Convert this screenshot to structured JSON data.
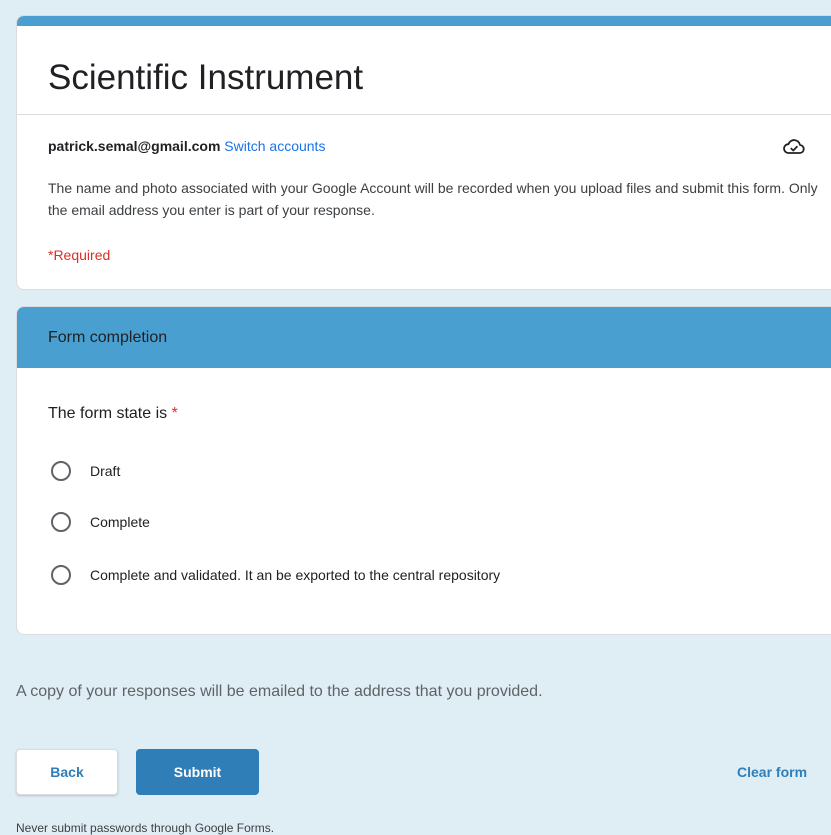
{
  "header": {
    "title": "Scientific Instrument",
    "account_email": "patrick.semal@gmail.com",
    "switch_accounts": "Switch accounts",
    "cloud_icon": "cloud-check-icon",
    "notice": "The name and photo associated with your Google Account will be recorded when you upload files and submit this form. Only the email address you enter is part of your response.",
    "required_note": "*Required"
  },
  "section": {
    "title": "Form completion",
    "question": "The form state is",
    "required_marker": "*",
    "options": [
      {
        "label": "Draft",
        "selected": false
      },
      {
        "label": "Complete",
        "selected": false
      },
      {
        "label": "Complete and validated. It an be exported to the central repository",
        "selected": false
      }
    ]
  },
  "copy_note": "A copy of your responses will be emailed to the address that you provided.",
  "actions": {
    "back": "Back",
    "submit": "Submit",
    "clear": "Clear form"
  },
  "footer": {
    "warning": "Never submit passwords through Google Forms."
  },
  "colors": {
    "accent": "#4a9fd1",
    "button": "#2f7eb8",
    "background": "#dfeef4",
    "required": "#d93025",
    "link": "#1a73e8"
  }
}
